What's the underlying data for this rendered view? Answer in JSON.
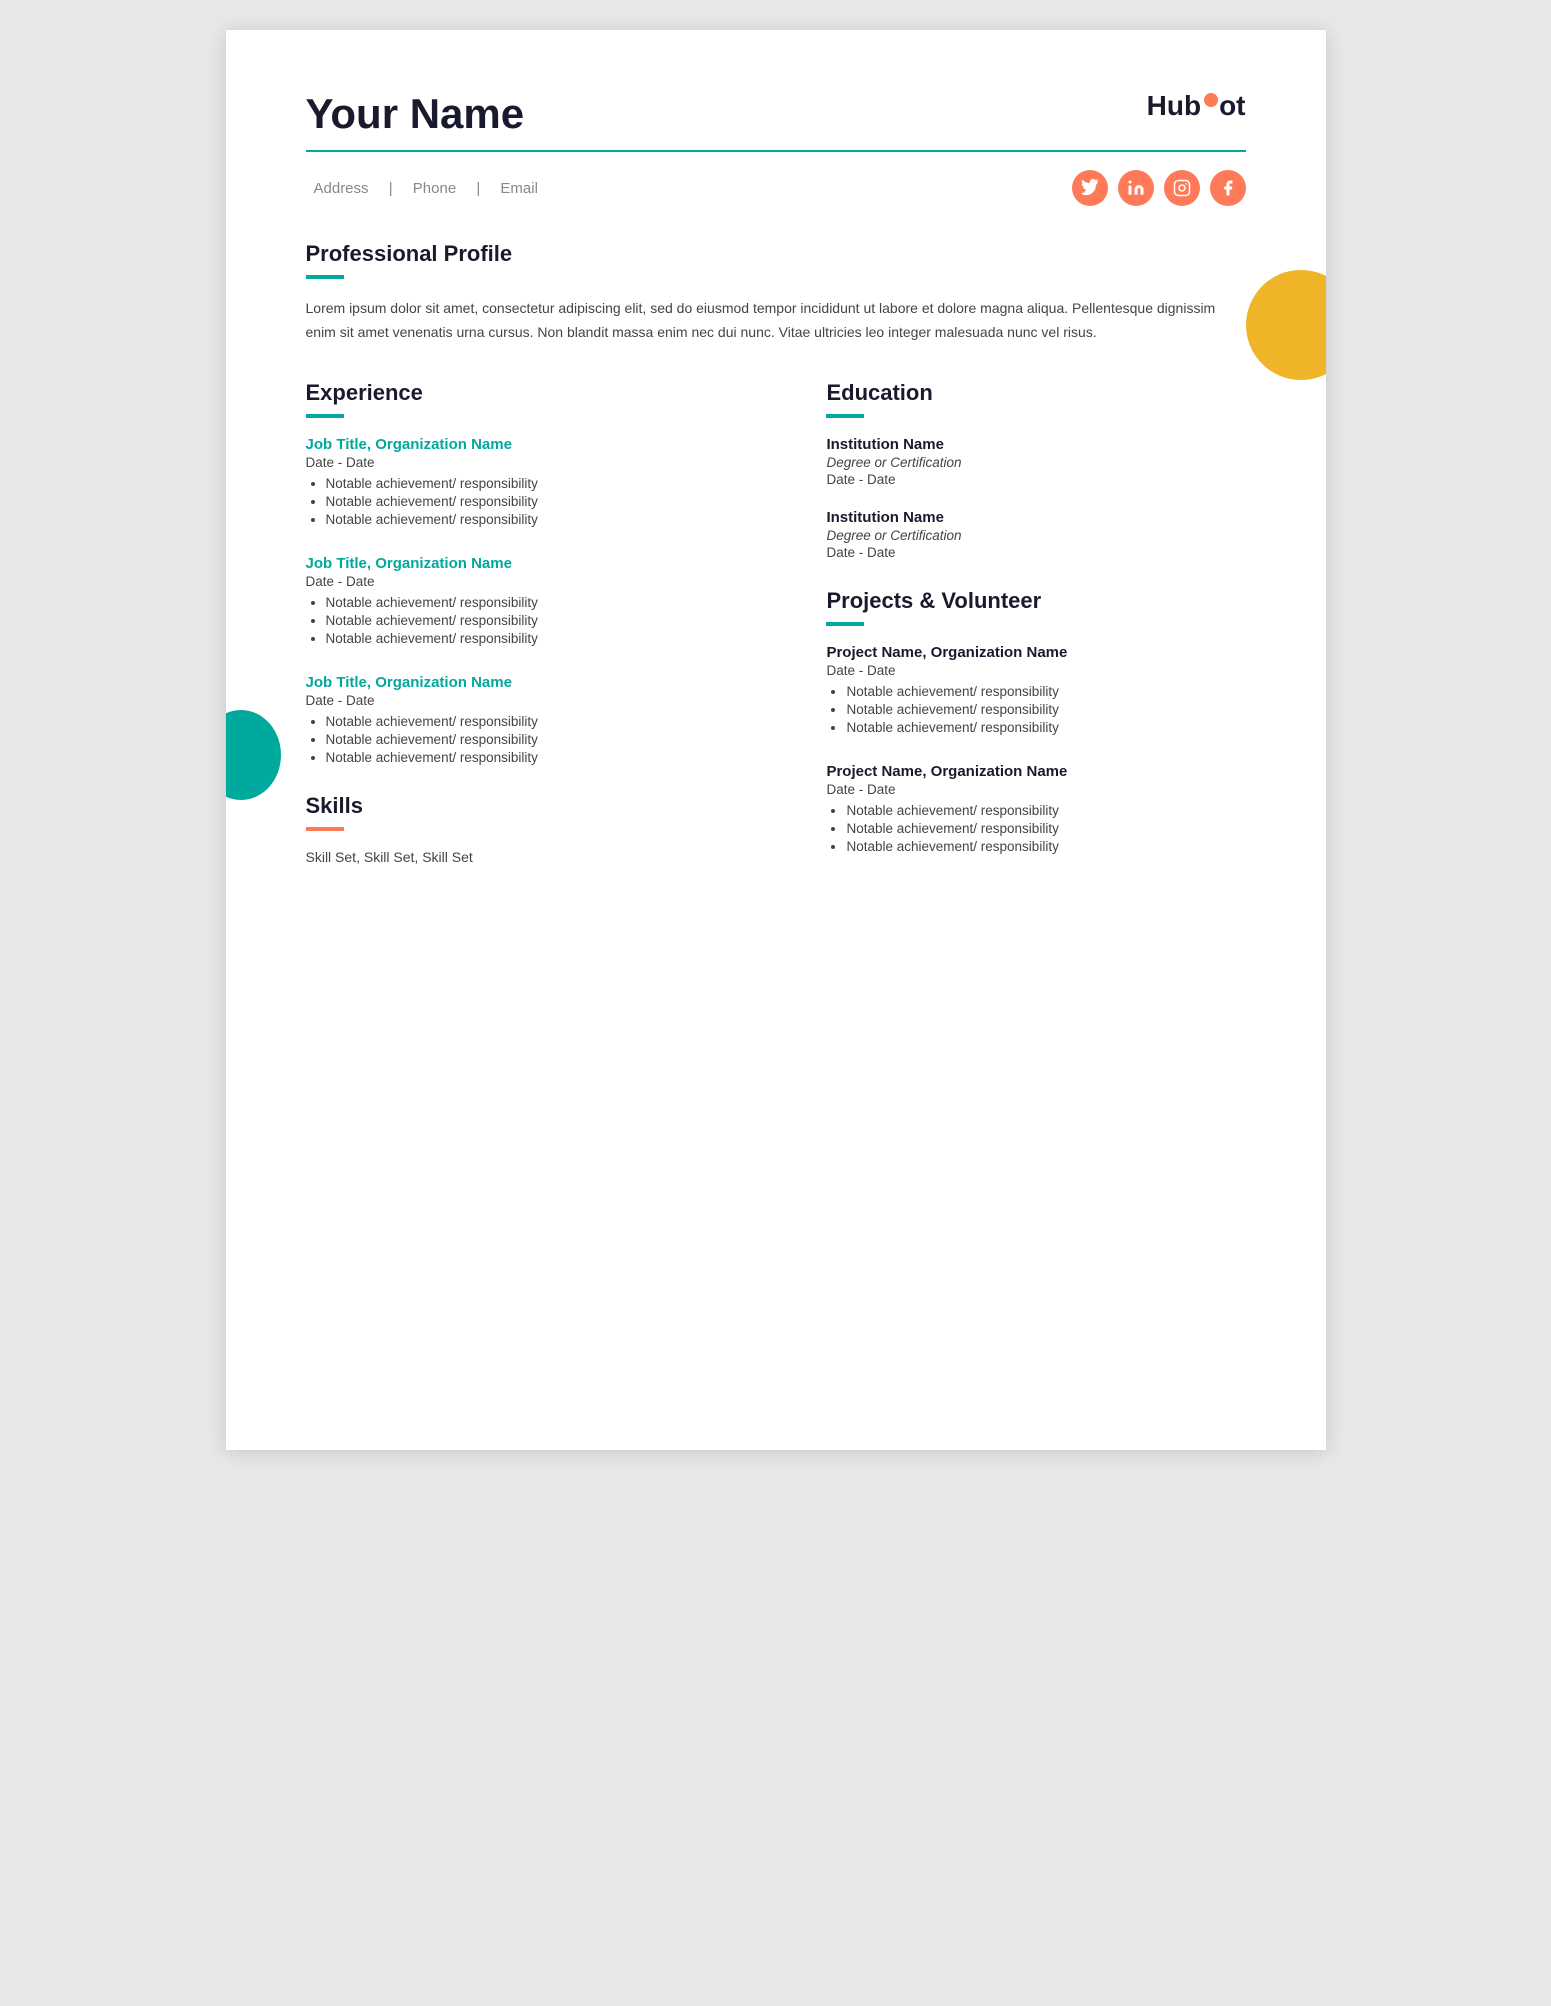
{
  "header": {
    "name": "Your Name",
    "hubspot": "HubSpot",
    "divider": true
  },
  "contact": {
    "address": "Address",
    "phone": "Phone",
    "email": "Email"
  },
  "social": {
    "icons": [
      "twitter",
      "linkedin",
      "instagram",
      "facebook"
    ]
  },
  "profile": {
    "title": "Professional Profile",
    "underline_color": "teal",
    "body": "Lorem ipsum dolor sit amet, consectetur adipiscing elit, sed do eiusmod tempor incididunt ut labore et dolore magna aliqua. Pellentesque dignissim enim sit amet venenatis urna cursus. Non blandit massa enim nec dui nunc. Vitae ultricies leo integer malesuada nunc vel risus."
  },
  "experience": {
    "title": "Experience",
    "underline_color": "teal",
    "jobs": [
      {
        "title": "Job Title, Organization Name",
        "date": "Date - Date",
        "bullets": [
          "Notable achievement/ responsibility",
          "Notable achievement/ responsibility",
          "Notable achievement/ responsibility"
        ]
      },
      {
        "title": "Job Title, Organization Name",
        "date": "Date - Date",
        "bullets": [
          "Notable achievement/ responsibility",
          "Notable achievement/ responsibility",
          "Notable achievement/ responsibility"
        ]
      },
      {
        "title": "Job Title, Organization Name",
        "date": "Date - Date",
        "bullets": [
          "Notable achievement/ responsibility",
          "Notable achievement/ responsibility",
          "Notable achievement/ responsibility"
        ]
      }
    ]
  },
  "skills": {
    "title": "Skills",
    "underline_color": "orange",
    "text": "Skill Set, Skill Set, Skill Set"
  },
  "education": {
    "title": "Education",
    "underline_color": "teal",
    "entries": [
      {
        "institution": "Institution Name",
        "degree": "Degree or Certification",
        "date": "Date - Date"
      },
      {
        "institution": "Institution Name",
        "degree": "Degree or Certification",
        "date": "Date - Date"
      }
    ]
  },
  "projects": {
    "title": "Projects & Volunteer",
    "underline_color": "teal",
    "entries": [
      {
        "title": "Project Name, Organization Name",
        "date": "Date - Date",
        "bullets": [
          "Notable achievement/ responsibility",
          "Notable achievement/ responsibility",
          "Notable achievement/ responsibility"
        ]
      },
      {
        "title": "Project Name, Organization Name",
        "date": "Date - Date",
        "bullets": [
          "Notable achievement/ responsibility",
          "Notable achievement/ responsibility",
          "Notable achievement/ responsibility"
        ]
      }
    ]
  }
}
